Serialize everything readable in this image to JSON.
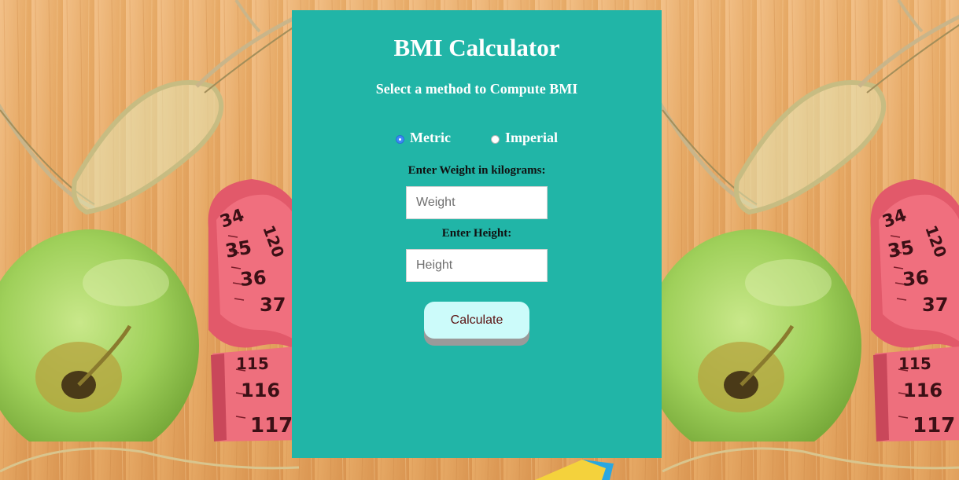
{
  "app": {
    "title": "BMI Calculator",
    "subtitle": "Select a method to Compute BMI"
  },
  "method": {
    "options": [
      {
        "label": "Metric",
        "selected": true
      },
      {
        "label": "Imperial",
        "selected": false
      }
    ]
  },
  "weight": {
    "label": "Enter Weight in kilograms:",
    "placeholder": "Weight",
    "value": ""
  },
  "height": {
    "label": "Enter Height:",
    "placeholder": "Height",
    "value": ""
  },
  "actions": {
    "calculate_label": "Calculate"
  },
  "background": {
    "tape_numbers": [
      "34",
      "35",
      "36",
      "37",
      "120",
      "115",
      "116",
      "117"
    ]
  },
  "colors": {
    "card": "#21b5a7",
    "title_text": "#ffffff",
    "label_text": "#111111",
    "button_bg": "#ccfbfa",
    "button_text": "#5a1010",
    "radio_checked": "#3d8bf6"
  }
}
